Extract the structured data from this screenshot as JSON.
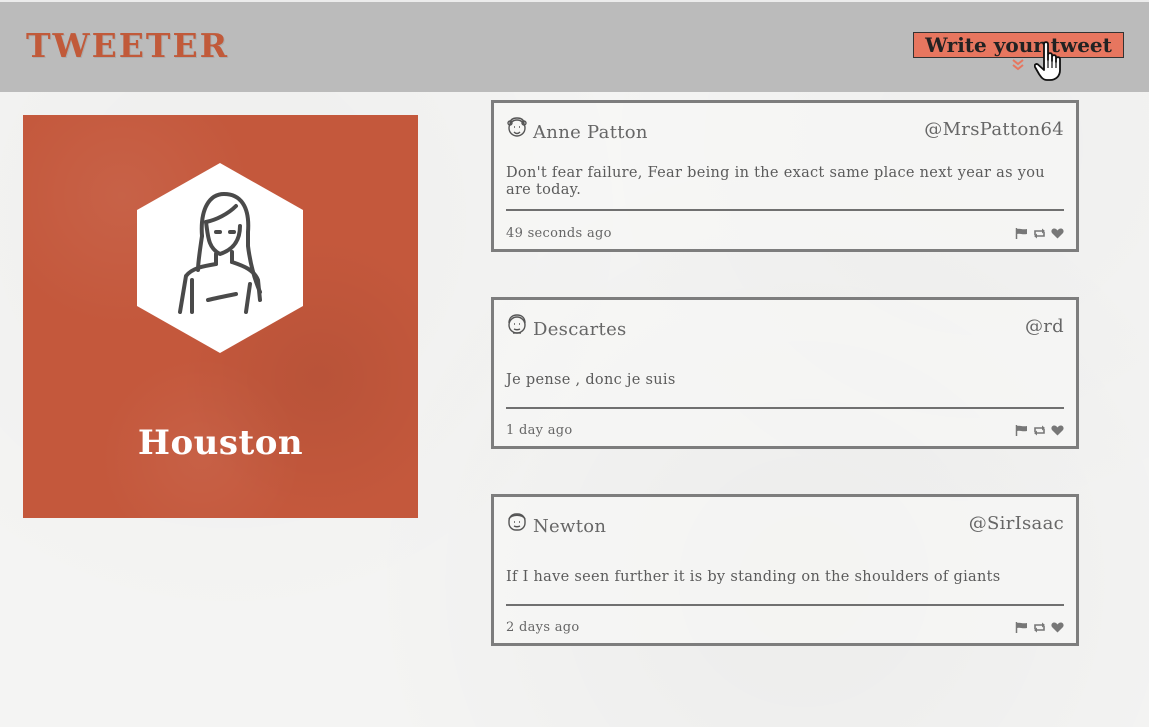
{
  "header": {
    "brand": "TWEETER",
    "compose_label": "Write your tweet"
  },
  "profile": {
    "name": "Houston"
  },
  "tweets": [
    {
      "name": "Anne Patton",
      "handle": "@MrsPatton64",
      "text": "Don't fear failure, Fear being in the exact same place next year as you are today.",
      "time": "49 seconds ago"
    },
    {
      "name": "Descartes",
      "handle": "@rd",
      "text": "Je pense , donc je suis",
      "time": "1 day ago"
    },
    {
      "name": "Newton",
      "handle": "@SirIsaac",
      "text": "If I have seen further it is by standing on the shoulders of giants",
      "time": "2 days ago"
    }
  ],
  "icons": {
    "compose": "chevron-double-down-icon",
    "actions": [
      "flag-icon",
      "retweet-icon",
      "heart-icon"
    ]
  },
  "colors": {
    "accent": "#c4583c",
    "compose_button": "#e7765f",
    "navbar": "#bbbbbb",
    "tweet_border": "#7d7d7d"
  }
}
